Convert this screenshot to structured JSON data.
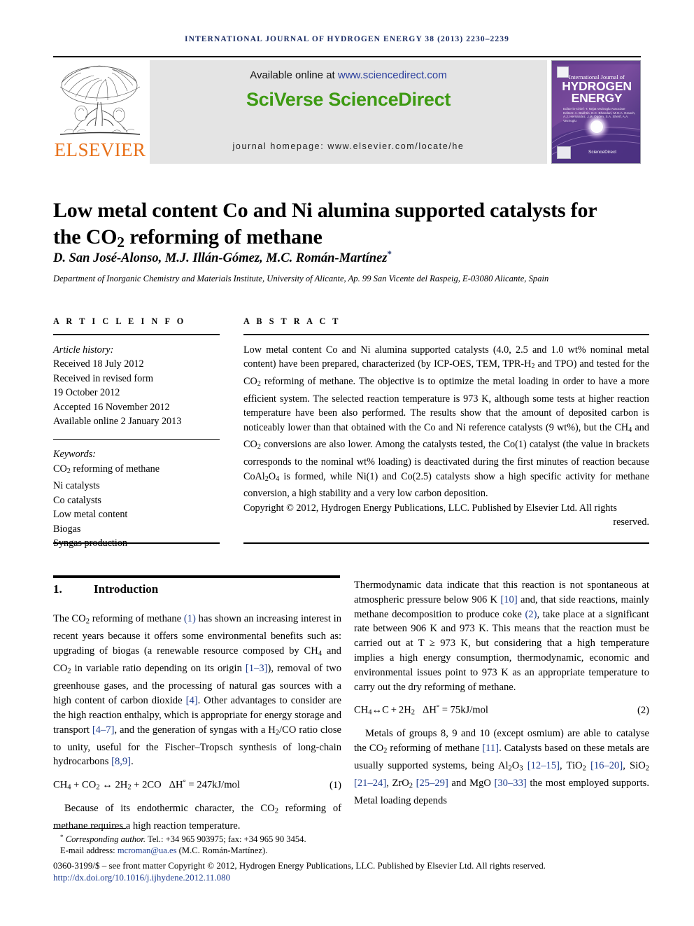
{
  "running_head": "INTERNATIONAL JOURNAL OF HYDROGEN ENERGY 38 (2013) 2230–2239",
  "masthead": {
    "publisher": "ELSEVIER",
    "available_prefix": "Available online at ",
    "available_url": "www.sciencedirect.com",
    "platform": "SciVerse ScienceDirect",
    "homepage": "journal homepage: www.elsevier.com/locate/he",
    "cover": {
      "line1": "International Journal of",
      "line2": "HYDROGEN",
      "line3": "ENERGY",
      "editors": "Editor-in-Chief:  T. Nejat Veziroglu\nAssociate Editors:  A. Bakhtin, D.C. Bhandari, M.G.A. Grasch, A.J. Hernandez, J.M. Ogden, S.A. Sherif, A.A. Veziroglu",
      "sciencedirect": "ScienceDirect"
    }
  },
  "article": {
    "title_line1": "Low metal content Co and Ni alumina supported catalysts for",
    "title_line2_pre": "the CO",
    "title_line2_sub": "2",
    "title_line2_post": " reforming of methane",
    "authors": "D. San José-Alonso, M.J. Illán-Gómez, M.C. Román-Martínez",
    "authors_star": "*",
    "affiliation": "Department of Inorganic Chemistry and Materials Institute, University of Alicante, Ap. 99 San Vicente del Raspeig, E-03080 Alicante, Spain"
  },
  "article_info": {
    "heading": "A R T I C L E   I N F O",
    "history_label": "Article history:",
    "history": [
      "Received 18 July 2012",
      "Received in revised form",
      "19 October 2012",
      "Accepted 16 November 2012",
      "Available online 2 January 2013"
    ],
    "keywords_label": "Keywords:",
    "keywords": [
      "CO2 reforming of methane",
      "Ni catalysts",
      "Co catalysts",
      "Low metal content",
      "Biogas",
      "Syngas production"
    ]
  },
  "abstract": {
    "heading": "A B S T R A C T",
    "paragraph": "Low metal content Co and Ni alumina supported catalysts (4.0, 2.5 and 1.0 wt% nominal metal content) have been prepared, characterized (by ICP-OES, TEM, TPR-H2 and TPO) and tested for the CO2 reforming of methane. The objective is to optimize the metal loading in order to have a more efficient system. The selected reaction temperature is 973 K, although some tests at higher reaction temperature have been also performed. The results show that the amount of deposited carbon is noticeably lower than that obtained with the Co and Ni reference catalysts (9 wt%), but the CH4 and CO2 conversions are also lower. Among the catalysts tested, the Co(1) catalyst (the value in brackets corresponds to the nominal wt% loading) is deactivated during the first minutes of reaction because CoAl2O4 is formed, while Ni(1) and Co(2.5) catalysts show a high specific activity for methane conversion, a high stability and a very low carbon deposition.",
    "copyright_main": "Copyright © 2012, Hydrogen Energy Publications, LLC. Published by Elsevier Ltd. All rights",
    "copyright_last": "reserved."
  },
  "introduction": {
    "number": "1.",
    "title": "Introduction",
    "p1_a": "The CO",
    "p1_b": " reforming of methane ",
    "p1_ref1": "(1)",
    "p1_c": " has shown an increasing interest in recent years because it offers some environmental benefits such as: upgrading of biogas (a renewable resource composed by CH",
    "p1_d": " and CO",
    "p1_e": " in variable ratio depending on its origin ",
    "p1_ref2": "[1–3]",
    "p1_f": "), removal of two greenhouse gases, and the processing of natural gas sources with a high content of carbon dioxide ",
    "p1_ref3": "[4]",
    "p1_g": ". Other advantages to consider are the high reaction enthalpy, which is appropriate for energy storage and transport ",
    "p1_ref4": "[4–7]",
    "p1_h": ", and the generation of syngas with a H",
    "p1_i": "/CO ratio close to unity, useful for the Fischer–Tropsch synthesis of long-chain hydrocarbons ",
    "p1_ref5": "[8,9]",
    "p1_j": ".",
    "eq1": "CH4 + CO2 ↔ 2H2 + 2CO    ΔH° = 247kJ/mol",
    "eq1_num": "(1)",
    "p2": "Because of its endothermic character, the CO2 reforming of methane requires a high reaction temperature.",
    "r_p1_a": "Thermodynamic data indicate that this reaction is not spontaneous at atmospheric pressure below 906 K ",
    "r_p1_ref1": "[10]",
    "r_p1_b": " and, that side reactions, mainly methane decomposition to produce coke ",
    "r_p1_ref2": "(2)",
    "r_p1_c": ", take place at a significant rate between 906 K and 973 K. This means that the reaction must be carried out at T ≥ 973 K, but considering that a high temperature implies a high energy consumption, thermodynamic, economic and environmental issues point to 973 K as an appropriate temperature to carry out the dry reforming of methane.",
    "eq2": "CH4 ↔ C + 2H2    ΔH° = 75kJ/mol",
    "eq2_num": "(2)",
    "r_p2_a": "Metals of groups 8, 9 and 10 (except osmium) are able to catalyse the CO2 reforming of methane ",
    "r_p2_ref1": "[11]",
    "r_p2_b": ". Catalysts based on these metals are usually supported systems, being Al2O3 ",
    "r_p2_ref2": "[12–15]",
    "r_p2_c": ", TiO2 ",
    "r_p2_ref3": "[16–20]",
    "r_p2_d": ", SiO2 ",
    "r_p2_ref4": "[21–24]",
    "r_p2_e": ", ZrO2 ",
    "r_p2_ref5": "[25–29]",
    "r_p2_f": " and MgO ",
    "r_p2_ref6": "[30–33]",
    "r_p2_g": " the most employed supports. Metal loading depends"
  },
  "footer": {
    "corresponding_star": "*",
    "corresponding_label": "Corresponding author.",
    "corresponding_contact": " Tel.: +34 965 903975; fax: +34 965 90 3454.",
    "email_label": "E-mail address: ",
    "email": "mcroman@ua.es",
    "email_owner": " (M.C. Román-Martínez).",
    "imprint": "0360-3199/$ – see front matter Copyright © 2012, Hydrogen Energy Publications, LLC. Published by Elsevier Ltd. All rights reserved.",
    "doi": "http://dx.doi.org/10.1016/j.ijhydene.2012.11.080"
  },
  "colors": {
    "elsevier_orange": "#E8711A",
    "sciverse_green": "#3d9a12",
    "link_blue": "#1f3d8f",
    "running_head_blue": "#1d2f66",
    "banner_gray": "#e4e4e4"
  }
}
